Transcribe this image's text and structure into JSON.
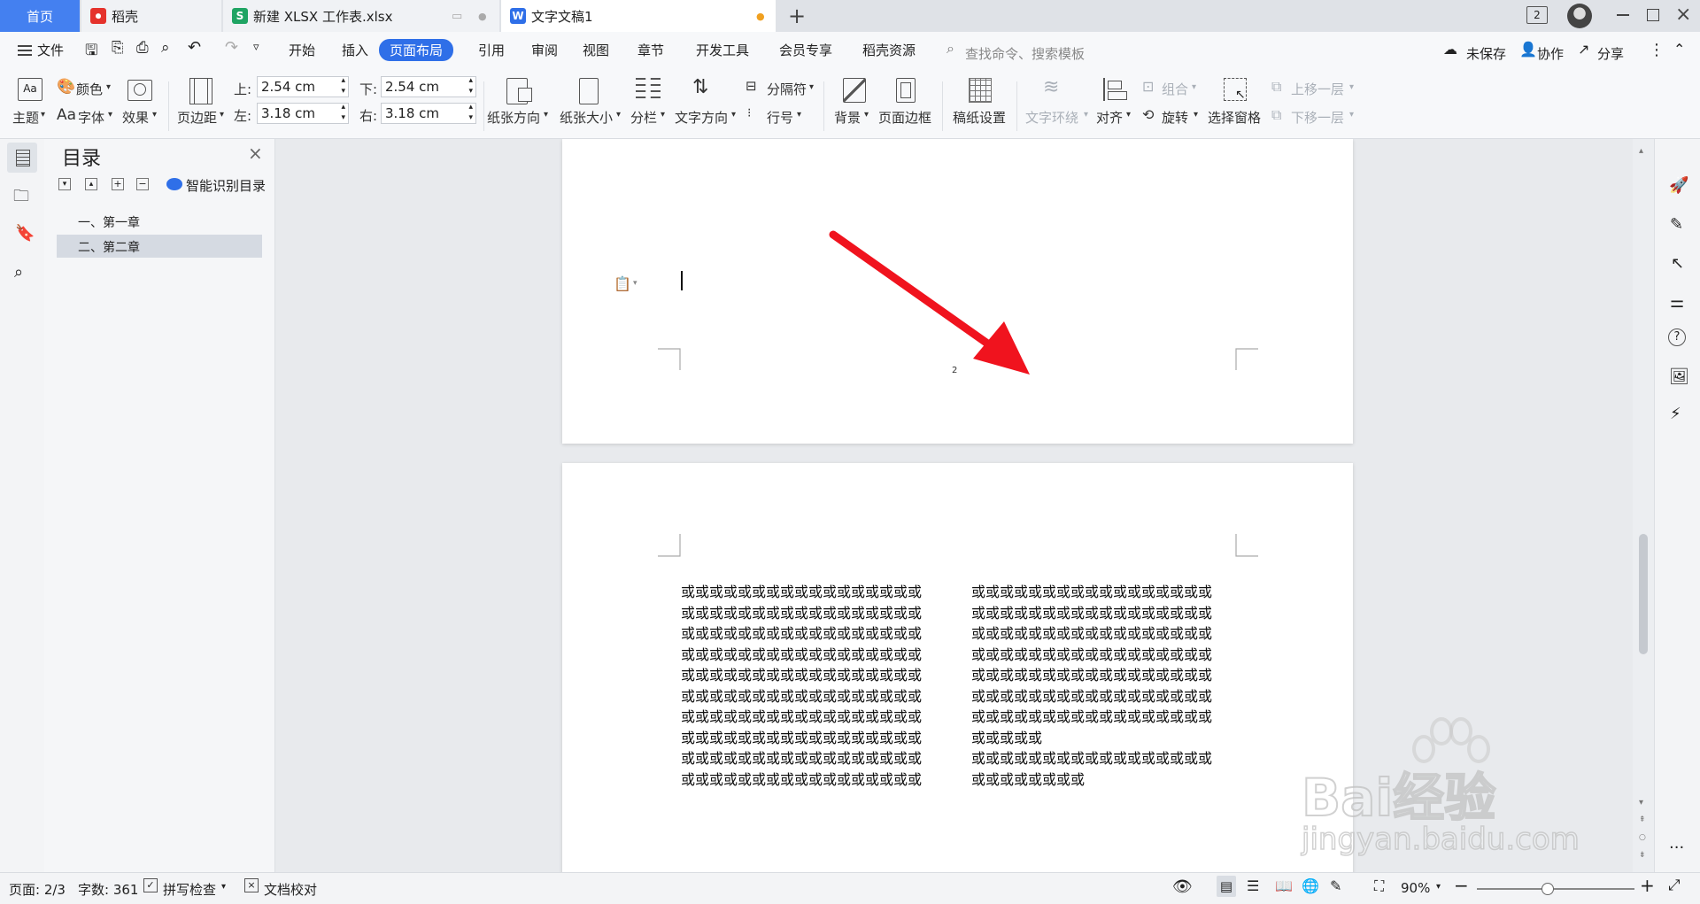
{
  "tabs": [
    {
      "label": "首页",
      "active": false,
      "home": true
    },
    {
      "label": "稻壳",
      "icon": "daoke-icon"
    },
    {
      "label": "新建 XLSX 工作表.xlsx",
      "icon": "spreadsheet-icon"
    },
    {
      "label": "文字文稿1",
      "icon": "writer-icon",
      "active": true
    }
  ],
  "window": {
    "badge": "2"
  },
  "menu": {
    "file": "文件",
    "items": [
      "开始",
      "插入",
      "页面布局",
      "引用",
      "审阅",
      "视图",
      "章节",
      "开发工具",
      "会员专享",
      "稻壳资源"
    ],
    "active_item": "页面布局",
    "search_placeholder": "查找命令、搜索模板",
    "unsaved": "未保存",
    "collab": "协作",
    "share": "分享"
  },
  "ribbon": {
    "theme": "主题",
    "color": "颜色",
    "font": "字体",
    "font_prefix": "Aa",
    "effect": "效果",
    "margins": "页边距",
    "top_label": "上:",
    "top_value": "2.54 cm",
    "bottom_label": "下:",
    "bottom_value": "2.54 cm",
    "left_label": "左:",
    "left_value": "3.18 cm",
    "right_label": "右:",
    "right_value": "3.18 cm",
    "orientation": "纸张方向",
    "size": "纸张大小",
    "columns": "分栏",
    "text_direction": "文字方向",
    "breaks": "分隔符",
    "line_numbers": "行号",
    "background": "背景",
    "page_border": "页面边框",
    "grid_paper": "稿纸设置",
    "text_wrap": "文字环绕",
    "align": "对齐",
    "rotate": "旋转",
    "group": "组合",
    "selection_pane": "选择窗格",
    "bring_forward": "上移一层",
    "send_backward": "下移一层"
  },
  "nav": {
    "title": "目录",
    "smart_toc": "智能识别目录",
    "items": [
      {
        "label": "一、第一章",
        "selected": false
      },
      {
        "label": "二、第二章",
        "selected": true
      }
    ]
  },
  "document": {
    "page_number": "2",
    "col1_lines": [
      "或或或或或或或或或或或或或或或或或",
      "或或或或或或或或或或或或或或或或或",
      "或或或或或或或或或或或或或或或或或",
      "或或或或或或或或或或或或或或或或或",
      "或或或或或或或或或或或或或或或或或",
      "或或或或或或或或或或或或或或或或或",
      "或或或或或或或或或或或或或或或或或",
      "或或或或或或或或或或或或或或或或或",
      "或或或或或或或或或或或或或或或或或",
      "或或或或或或或或或或或或或或或或或"
    ],
    "col2_lines": [
      "或或或或或或或或或或或或或或或或或",
      "或或或或或或或或或或或或或或或或或",
      "或或或或或或或或或或或或或或或或或",
      "或或或或或或或或或或或或或或或或或",
      "或或或或或或或或或或或或或或或或或",
      "或或或或或或或或或或或或或或或或或",
      "或或或或或或或或或或或或或或或或或",
      "或或或或或",
      "或或或或或或或或或或或或或或或或或",
      "或或或或或或或或"
    ]
  },
  "status": {
    "page": "页面: 2/3",
    "words": "字数: 361",
    "spell": "拼写检查",
    "proof": "文档校对",
    "zoom": "90%",
    "zoom_level": 0.9
  },
  "watermark": {
    "brand": "Bai经验",
    "url": "jingyan.baidu.com"
  },
  "colors": {
    "accent": "#2f6fe8",
    "arrow": "#f0131e",
    "tab_active": "#ffffff",
    "home_tab": "#4480f0",
    "daoke": "#e5322c",
    "sheet": "#1fa463",
    "writer": "#2f6fe8"
  }
}
